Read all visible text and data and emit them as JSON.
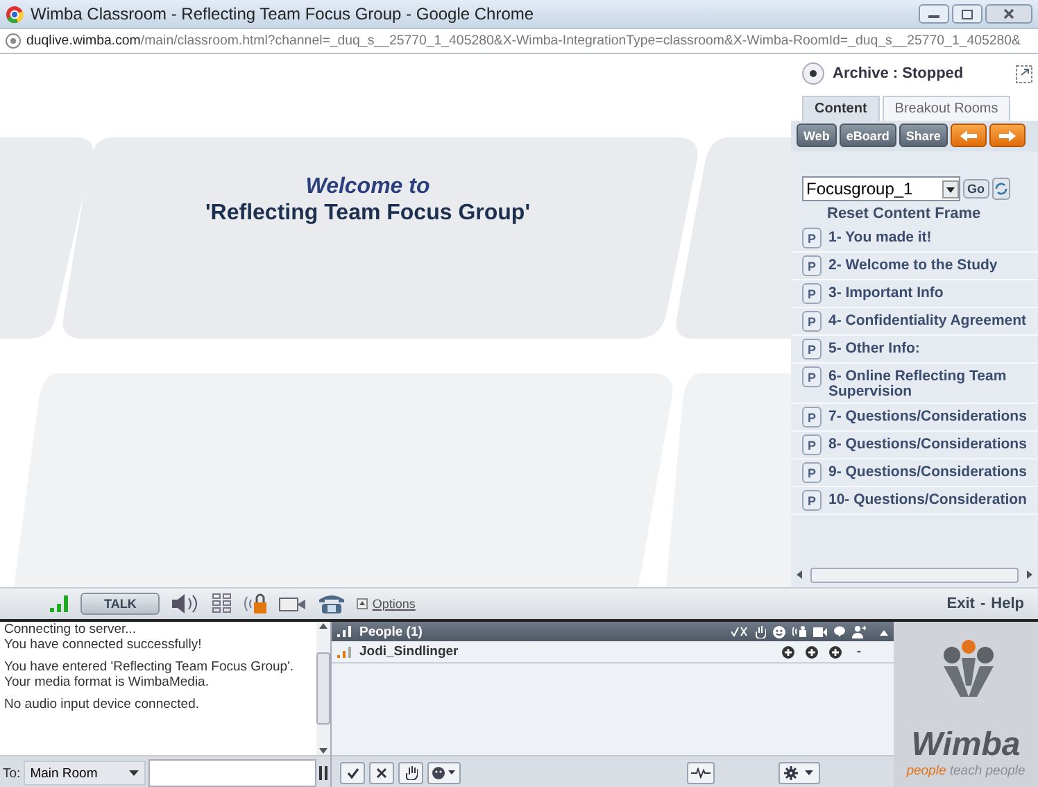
{
  "window": {
    "title": "Wimba Classroom - Reflecting Team Focus Group - Google Chrome"
  },
  "address": {
    "host": "duqlive.wimba.com",
    "path": "/main/classroom.html?channel=_duq_s__25770_1_405280&X-Wimba-IntegrationType=classroom&X-Wimba-RoomId=_duq_s__25770_1_405280&"
  },
  "slide": {
    "heading": "Welcome to",
    "title": "'Reflecting Team Focus Group'"
  },
  "archive": {
    "status": "Archive : Stopped"
  },
  "tabs": [
    {
      "label": "Content",
      "selected": true
    },
    {
      "label": "Breakout Rooms",
      "selected": false
    }
  ],
  "content_buttons": [
    "Web",
    "eBoard",
    "Share"
  ],
  "content_select": {
    "value": "Focusgroup_1",
    "go": "Go"
  },
  "reset_link": "Reset Content Frame",
  "pages": [
    {
      "badge": "P",
      "label": "1- You made it!"
    },
    {
      "badge": "P",
      "label": "2- Welcome to the Study"
    },
    {
      "badge": "P",
      "label": "3- Important Info"
    },
    {
      "badge": "P",
      "label": "4- Confidentiality Agreement"
    },
    {
      "badge": "P",
      "label": "5- Other Info:"
    },
    {
      "badge": "P",
      "label": "6- Online Reflecting Team Supervision"
    },
    {
      "badge": "P",
      "label": "7- Questions/Considerations"
    },
    {
      "badge": "P",
      "label": "8- Questions/Considerations"
    },
    {
      "badge": "P",
      "label": "9- Questions/Considerations"
    },
    {
      "badge": "P",
      "label": "10- Questions/Consideration"
    }
  ],
  "media_bar": {
    "talk": "TALK",
    "options": "Options",
    "links": [
      "Exit",
      "Help"
    ],
    "separator": "-"
  },
  "chat": {
    "messages": [
      [
        "Connecting to server...",
        "You have connected successfully!"
      ],
      [
        "You have entered 'Reflecting Team Focus Group'.",
        "Your media format is WimbaMedia."
      ],
      [
        "No audio input device connected."
      ]
    ],
    "to_label": "To:",
    "room": "Main Room"
  },
  "people": {
    "header": "People (1)",
    "members": [
      {
        "name": "Jodi_Sindlinger",
        "status": [
          {
            "kind": "plus"
          },
          {
            "kind": "plus"
          },
          {
            "kind": "plus"
          },
          {
            "kind": "dash",
            "text": "-"
          }
        ]
      }
    ]
  },
  "logo": {
    "name": "Wimba",
    "tagline_accent": "people",
    "tagline": "teach people"
  }
}
